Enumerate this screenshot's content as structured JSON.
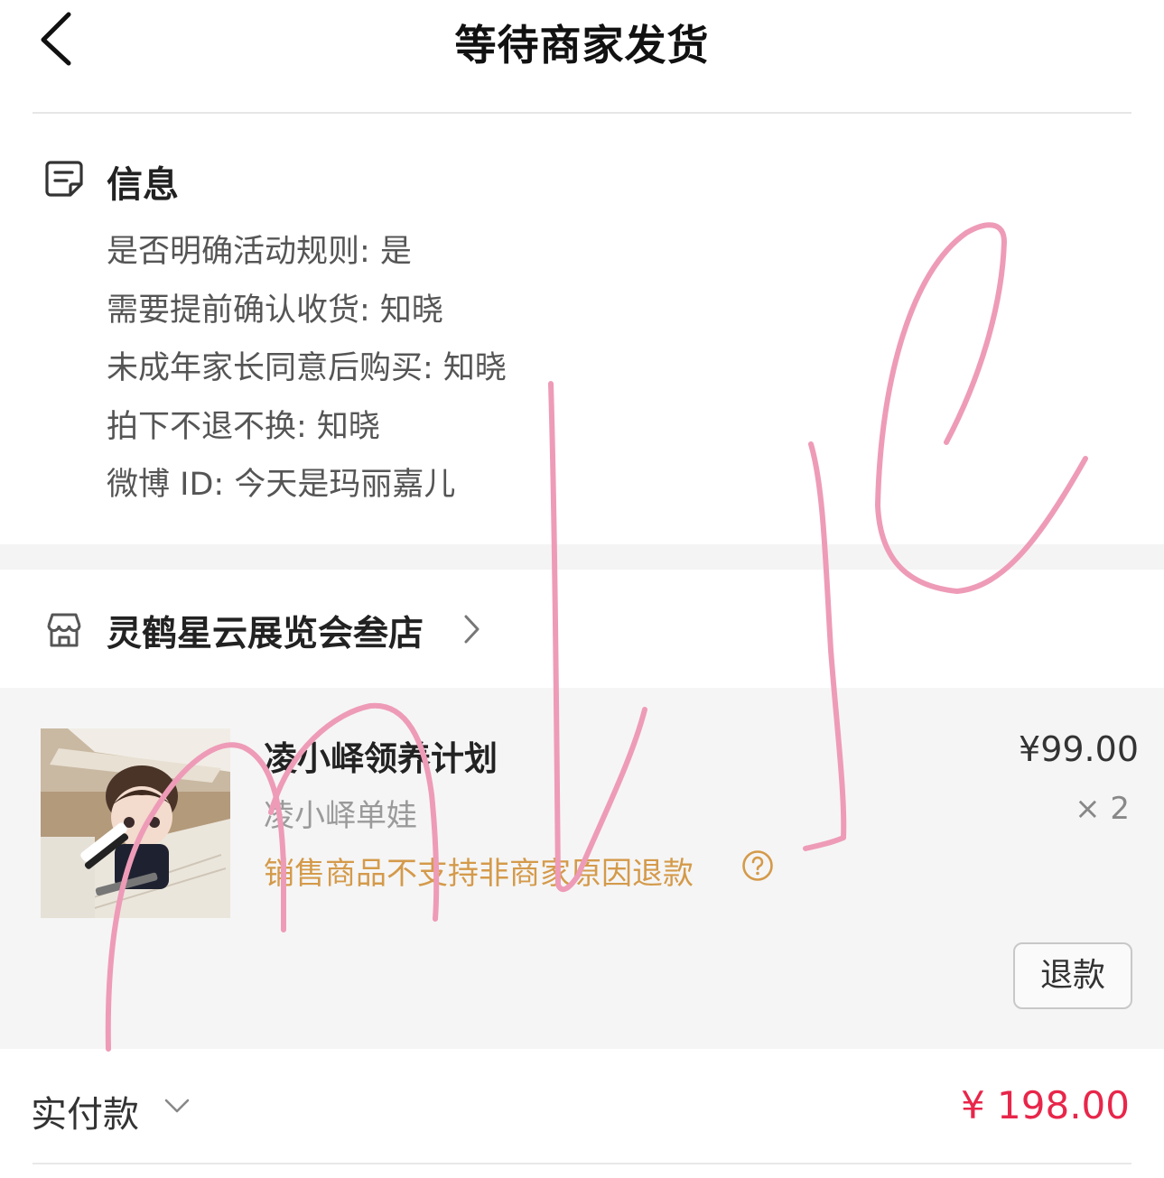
{
  "header": {
    "title": "等待商家发货"
  },
  "info": {
    "title": "信息",
    "lines": [
      "是否明确活动规则: 是",
      "需要提前确认收货: 知晓",
      "未成年家长同意后购买: 知晓",
      "拍下不退不换: 知晓",
      "微博 ID: 今天是玛丽嘉儿"
    ]
  },
  "shop": {
    "name": "灵鹤星云展览会叁店"
  },
  "product": {
    "name": "凌小峄领养计划",
    "sku": "凌小峄单娃",
    "price": "¥99.00",
    "quantity": "× 2",
    "refund_notice": "销售商品不支持非商家原因退款",
    "refund_button": "退款"
  },
  "total": {
    "label": "实付款",
    "amount": "¥ 198.00"
  },
  "colors": {
    "accent_red": "#e8264a",
    "notice_orange": "#d49a4a",
    "scribble_pink": "#ee9bb8"
  },
  "icons": {
    "back": "chevron-left-icon",
    "info": "note-icon",
    "shop": "store-icon",
    "help": "question-circle-icon",
    "dropdown": "chevron-down-icon"
  }
}
